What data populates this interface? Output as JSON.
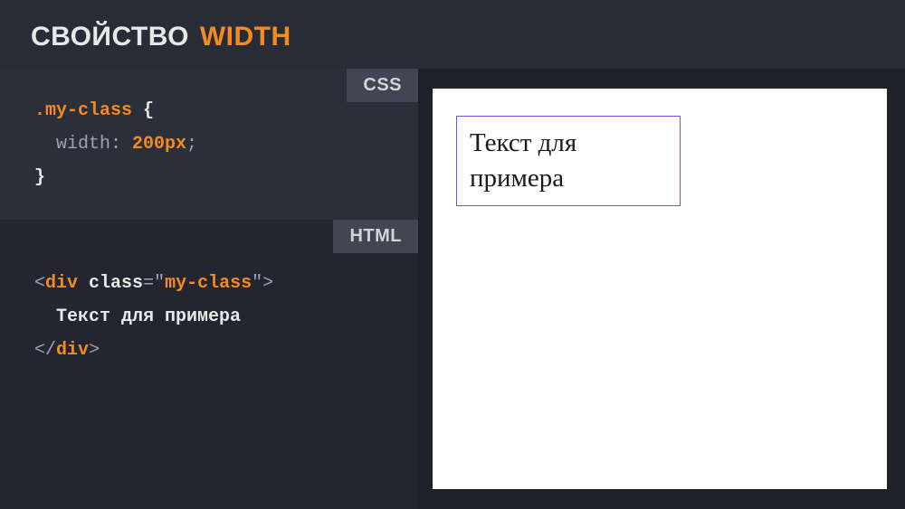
{
  "header": {
    "word1": "СВОЙСТВО",
    "word2": "WIDTH"
  },
  "tabs": {
    "css": "CSS",
    "html": "HTML"
  },
  "cssCode": {
    "selector": ".my-class",
    "openBrace": " {",
    "prop": "width",
    "colon": ": ",
    "value": "200px",
    "semicolon": ";",
    "closeBrace": "}"
  },
  "htmlCode": {
    "open_lt": "<",
    "tag": "div",
    "attr": "class",
    "eq": "=",
    "q": "\"",
    "attrValue": "my-class",
    "close_gt": ">",
    "inner": "Текст для примера",
    "close_open": "</",
    "close_close": ">"
  },
  "preview": {
    "text": "Текст для примера"
  }
}
